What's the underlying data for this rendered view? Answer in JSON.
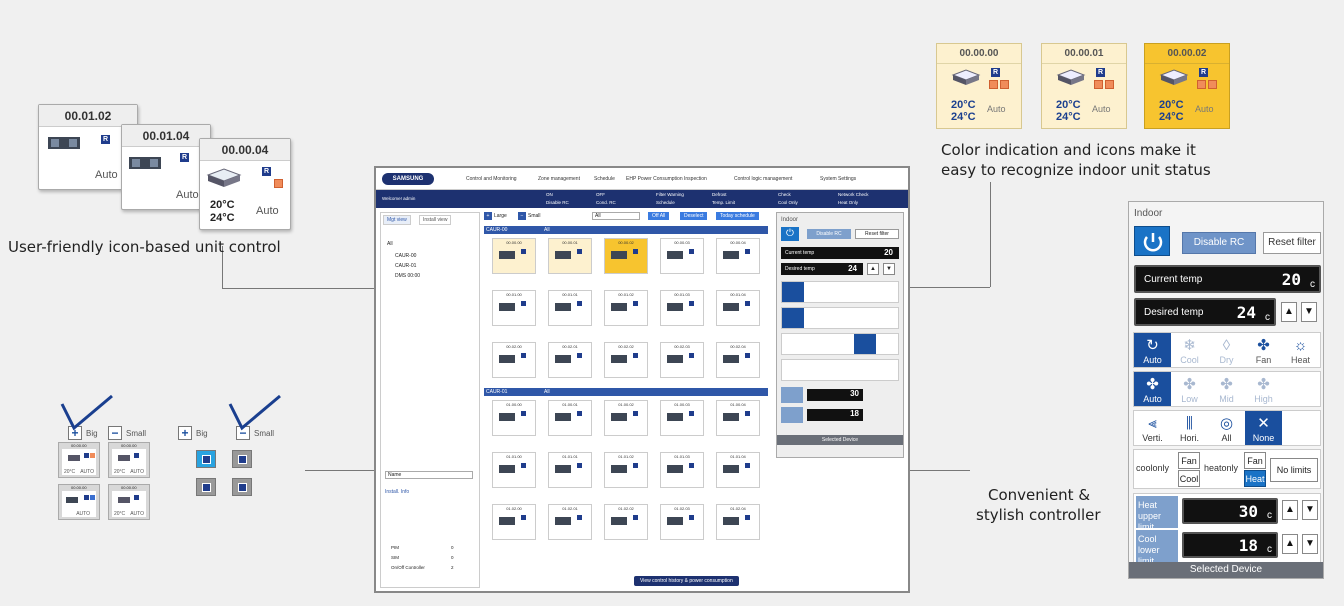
{
  "captions": {
    "left": "User-friendly icon-based unit control",
    "top_right_1": "Color indication and icons make it",
    "top_right_2": "easy to recognize indoor unit status",
    "right_1": "Convenient &",
    "right_2": "stylish controller"
  },
  "left_cards": [
    {
      "id": "00.01.02",
      "mode": "Auto",
      "badge": "R"
    },
    {
      "id": "00.01.04",
      "mode": "Auto",
      "badge": "R"
    },
    {
      "id": "00.00.04",
      "mode": "Auto",
      "badge": "R",
      "temp_heat": "20°C",
      "temp_cool": "24°C"
    }
  ],
  "top_right_cards": [
    {
      "id": "00.00.00",
      "temp_heat": "20°C",
      "temp_cool": "24°C",
      "mode": "Auto"
    },
    {
      "id": "00.00.01",
      "temp_heat": "20°C",
      "temp_cool": "24°C",
      "mode": "Auto"
    },
    {
      "id": "00.00.02",
      "temp_heat": "20°C",
      "temp_cool": "24°C",
      "mode": "Auto",
      "selected": true
    }
  ],
  "size_compare": {
    "big": "Big",
    "small": "Small",
    "mini_ids": [
      "00.00.00",
      "00.00.00",
      "00.00.00",
      "00.00.00"
    ],
    "mini_modes": [
      "AUTO",
      "AUTO",
      "AUTO",
      "AUTO"
    ],
    "mini_temps": [
      "20°C",
      "20°C",
      "",
      "20°C"
    ]
  },
  "screen": {
    "brand": "SAMSUNG",
    "nav": [
      "Control and Monitoring",
      "Zone management",
      "Schedule",
      "EHP Power Consumption Inspection",
      "Control logic management",
      "System Settings"
    ],
    "welcome": "Welcome! admin",
    "legend": [
      "ON",
      "Disable RC",
      "OFF",
      "Cond. RC",
      "Filter Warning",
      "Schedule",
      "Defrost",
      "Temp. Limit",
      "Check",
      "Cool Only",
      "Network Check",
      "Heat Only"
    ],
    "tabs": [
      "Mgt view",
      "Install view"
    ],
    "tree": [
      "All",
      "CAUR-00",
      "CAUR-01",
      "DMS 00:00"
    ],
    "toolbar": {
      "large": "Large",
      "small": "Small",
      "all": "All",
      "off_all": "Off All",
      "deselect": "Deselect",
      "today_schedule": "Today schedule"
    },
    "groups": [
      "CAUR-00",
      "CAUR-01"
    ],
    "group_filter": "All",
    "grid_rows_1": [
      [
        "00.00.00",
        "00.00.01",
        "00.00.02",
        "00.00.03",
        "00.00.04"
      ],
      [
        "00.01.00",
        "00.01.01",
        "00.01.02",
        "00.01.03",
        "00.01.04"
      ],
      [
        "00.02.00",
        "00.02.01",
        "00.02.02",
        "00.02.03",
        "00.02.04"
      ]
    ],
    "grid_rows_2": [
      [
        "01.00.00",
        "01.00.01",
        "01.00.02",
        "01.00.03",
        "01.00.04"
      ],
      [
        "01.01.00",
        "01.01.01",
        "01.01.02",
        "01.01.03",
        "01.01.04"
      ],
      [
        "01.02.00",
        "01.02.01",
        "01.02.02",
        "01.02.03",
        "01.02.04"
      ]
    ],
    "name_select": "Name",
    "install_info": "Install. Info",
    "info_rows": [
      [
        "PIM",
        "0"
      ],
      [
        "SIM",
        "0"
      ],
      [
        "On/Off Controller",
        "2"
      ]
    ],
    "footer_button": "View control history & power consumption"
  },
  "controller": {
    "title": "Indoor",
    "disable_rc": "Disable RC",
    "reset_filter": "Reset filter",
    "current_temp_label": "Current temp",
    "current_temp_value": "20",
    "desired_temp_label": "Desired temp",
    "desired_temp_value": "24",
    "modes": [
      "Auto",
      "Cool",
      "Dry",
      "Fan",
      "Heat"
    ],
    "fan_speeds": [
      "Auto",
      "Low",
      "Mid",
      "High"
    ],
    "swing": [
      "Verti.",
      "Hori.",
      "All",
      "None"
    ],
    "limit_opts": {
      "coolonly": "coolonly",
      "fan": "Fan",
      "cool": "Cool",
      "heatonly": "heatonly",
      "heat": "Heat",
      "no_limits": "No limits"
    },
    "heat_upper_label": "Heat upper limit",
    "heat_upper_value": "30",
    "cool_lower_label": "Cool lower limit",
    "cool_lower_value": "18",
    "unit": "c",
    "selected_device": "Selected Device"
  },
  "colors": {
    "accent": "#1a73c6",
    "navy": "#1d3170",
    "selected": "#f7c42f",
    "warm": "#fdf1cf"
  }
}
